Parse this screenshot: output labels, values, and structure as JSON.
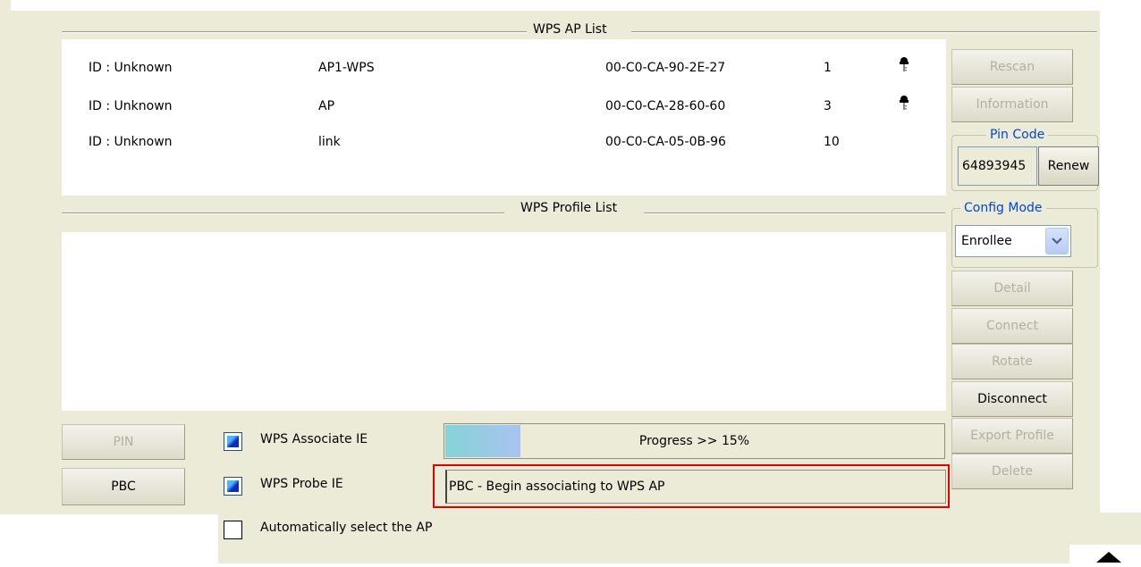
{
  "ap_list": {
    "title": "WPS AP List",
    "rows": [
      {
        "id": "ID : Unknown",
        "ssid": "AP1-WPS",
        "bssid": "00-C0-CA-90-2E-27",
        "channel": "1",
        "security_icon": "key-icon",
        "secured": true
      },
      {
        "id": "ID : Unknown",
        "ssid": "AP",
        "bssid": "00-C0-CA-28-60-60",
        "channel": "3",
        "security_icon": "key-icon",
        "secured": true
      },
      {
        "id": "ID : Unknown",
        "ssid": "link",
        "bssid": "00-C0-CA-05-0B-96",
        "channel": "10",
        "security_icon": "",
        "secured": false
      }
    ]
  },
  "profile_list": {
    "title": "WPS Profile List"
  },
  "side_buttons": {
    "rescan": "Rescan",
    "information": "Information",
    "detail": "Detail",
    "connect": "Connect",
    "rotate": "Rotate",
    "disconnect": "Disconnect",
    "export_profile": "Export Profile",
    "delete": "Delete"
  },
  "pin_code": {
    "legend": "Pin Code",
    "value": "64893945",
    "renew": "Renew"
  },
  "config_mode": {
    "legend": "Config Mode",
    "selected": "Enrollee"
  },
  "bottom": {
    "pin_button": "PIN",
    "pbc_button": "PBC",
    "wps_associate_ie": {
      "label": "WPS Associate IE",
      "checked": true
    },
    "wps_probe_ie": {
      "label": "WPS Probe IE",
      "checked": true
    },
    "auto_select": {
      "label": "Automatically select the AP",
      "checked": false
    },
    "progress_text": "Progress >> 15%",
    "progress_value": 0.15,
    "status_message": "PBC - Begin associating to WPS AP"
  },
  "colors": {
    "panel_bg": "#ecebd8",
    "legend_text": "#0046d5",
    "highlight_border": "#e50000",
    "disabled_text": "#b2b0a2"
  }
}
